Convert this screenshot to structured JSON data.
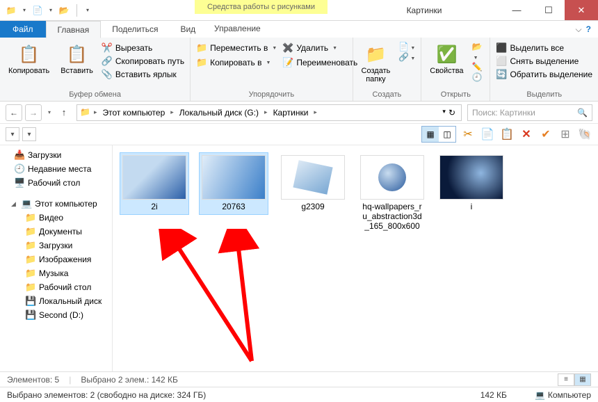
{
  "window": {
    "title": "Картинки",
    "context_tab": "Средства работы с рисунками"
  },
  "tabs": {
    "file": "Файл",
    "home": "Главная",
    "share": "Поделиться",
    "view": "Вид",
    "manage": "Управление"
  },
  "ribbon": {
    "clipboard": {
      "label": "Буфер обмена",
      "copy": "Копировать",
      "paste": "Вставить",
      "cut": "Вырезать",
      "copypath": "Скопировать путь",
      "pastelink": "Вставить ярлык"
    },
    "organize": {
      "label": "Упорядочить",
      "moveto": "Переместить в",
      "copyto": "Копировать в",
      "delete": "Удалить",
      "rename": "Переименовать"
    },
    "new": {
      "label": "Создать",
      "newfolder": "Создать\nпапку"
    },
    "open": {
      "label": "Открыть",
      "props": "Свойства"
    },
    "select": {
      "label": "Выделить",
      "selectall": "Выделить все",
      "selectnone": "Снять выделение",
      "invert": "Обратить выделение"
    }
  },
  "breadcrumb": {
    "items": [
      "Этот компьютер",
      "Локальный диск (G:)",
      "Картинки"
    ]
  },
  "search": {
    "placeholder": "Поиск: Картинки"
  },
  "tree": {
    "favorites": {
      "downloads": "Загрузки",
      "recent": "Недавние места",
      "desktop": "Рабочий стол"
    },
    "thispc_label": "Этот компьютер",
    "thispc": {
      "videos": "Видео",
      "documents": "Документы",
      "downloads": "Загрузки",
      "pictures": "Изображения",
      "music": "Музыка",
      "desktop": "Рабочий стол",
      "localdisk": "Локальный диск",
      "second": "Second (D:)"
    }
  },
  "files": [
    {
      "name": "2i",
      "selected": true
    },
    {
      "name": "20763",
      "selected": true
    },
    {
      "name": "g2309",
      "selected": false
    },
    {
      "name": "hq-wallpapers_ru_abstraction3d_165_800x600",
      "selected": false
    },
    {
      "name": "i",
      "selected": false
    }
  ],
  "status": {
    "count_label": "Элементов: 5",
    "selected_label": "Выбрано 2 элем.: 142 КБ",
    "selected_info": "Выбрано элементов: 2 (свободно на диске: 324 ГБ)",
    "size": "142 КБ",
    "computer": "Компьютер"
  }
}
